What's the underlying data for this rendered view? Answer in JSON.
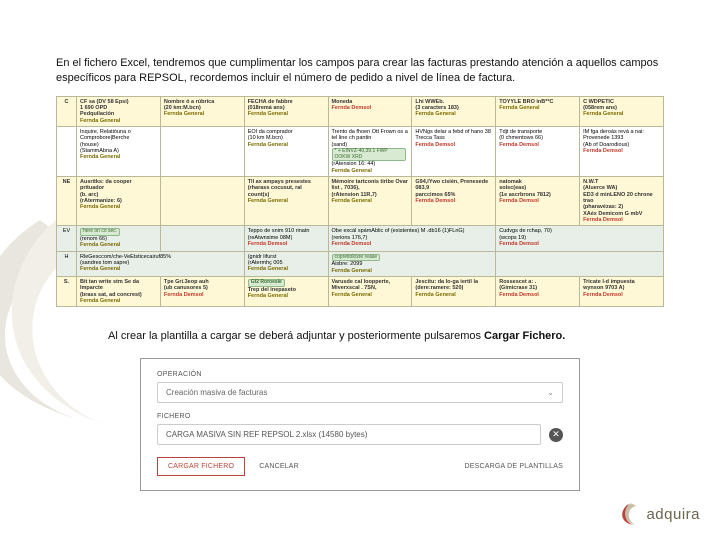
{
  "intro": "En el fichero Excel,  tendremos que cumplimentar los campos para crear las facturas prestando atención a aquellos campos específicos para REPSOL, recordemos incluir el número de pedido a nivel de línea de factura.",
  "table": {
    "r1": {
      "c0": "C",
      "c1a": "CF sa (DV 58 Epsi)",
      "c1b": "1 690 OPD",
      "c1c": "Pedquilación",
      "c1d": "",
      "c2a": "Nombre ó a rúbrica",
      "c2b": "(20 km:M.bcn)",
      "c3a": "FECHA de fabbre",
      "c3b": "(018remá ans)",
      "c3c": "",
      "c4a": "Moneda",
      "c4b": "",
      "c5a": "Lhi WWEb.",
      "c5b": "(3 caracters 183)",
      "c6a": "TOYYLE BRO inB**C",
      "c6b": "",
      "c7a": "C WDPETIC",
      "c7b": "(058rem ans)"
    },
    "r2": {
      "c1a": "Inquire, Relatióuna o Comprobore|Berche",
      "c1b": "(house)",
      "c1c": "(StammAbna A)",
      "c2": "",
      "c3a": "EOI da comprador",
      "c3b": "(10 km M.bcn)",
      "c3c": "",
      "c4a": "Trento da fhoen Ott Frown os a tel line ch pantin",
      "c4b": "(sand)",
      "c4c": "* + EINVZ-40,39.1 FWP OOKW XRD",
      "c4d": "(rAtension 16: 44)",
      "c4e": "",
      "c5a": "HVNgs delar a febd of hano 38",
      "c5b": "Trecca Tass",
      "c6a": "Tdjt de transporte",
      "c6b": "(0 chmentows 66)",
      "c7a": "IM fga deroás revá a nai:",
      "c7b": "Provenede 1393",
      "c7c": "(Ab of Doarodious)",
      "c7d": ""
    },
    "r3": {
      "c0": "NE",
      "c1a": "Ausritks: da cooper prituador",
      "c1b": "(b. arc)",
      "c1c": "(rAtermanize: 6)",
      "c2": "",
      "c3a": "Tll ax ampays presestes",
      "c3b": "(rharass cocusut, ral count(s)",
      "c4a": "Mémoire tartconis tiribe Ovar list , 7036),",
      "c4b": "(rAtension 11R,7)",
      "c5a": "G94,lYwo cisién, Prenesede 083,9",
      "c5b": "parccimos 65%",
      "c6a": "natomak",
      "c6b": "solsc(eas)",
      "c6c": "(1e ascrbrons 7812)",
      "c6d": "",
      "c7a": "N.W.T",
      "c7b": "(Aluerce WA)",
      "c7c": "ED3 d minLENO 20 chrone trao",
      "c7d": "(pharavézas: 2)",
      "c7e": "XAéx Demicom G mbV",
      "c7f": ""
    },
    "r4": {
      "c0": "EV",
      "c1a": "here on co sec.",
      "c1b": "(renom 66)",
      "c1c": "",
      "c3a": "Teppo de snim 910 rinatn",
      "c3b": "(reAtwnsime 08M)",
      "c3c": "",
      "c4a": "Obe excál spámAblic of (existentes) M  .db16 (1)FLnG)",
      "c4b": "(rerions 176,7)",
      "c4c": "",
      "c5a": "Cudvgs de rchap, 70)",
      "c5b": "(wcops 19)",
      "c5c": ""
    },
    "r5": {
      "c0": "H",
      "c1a": "RleGesccom/che-VeEtsticecairuf85%",
      "c1b": "(sandres tom sapre)",
      "c1c": "",
      "c3a": "(gnidr lifurst",
      "c3b": "(rAtermhç 005",
      "c3c": "",
      "c4a": "copretiolosre reáse",
      "c4b": "Aisbre: 2099",
      "c4c": ""
    },
    "r6": {
      "c0": "S.",
      "c1a": "Bit   tan write stm",
      "c1b": "Se da lmparcte",
      "c1c": "(brass sat, ad concrest)",
      "c2a": "Tpe Grí.3eop auh",
      "c2b": "(ub canusores 5)",
      "c2c": "",
      "c3a": "Gf2 Roroesle",
      "c3b": "Trep del inepaseto",
      "c3c": "",
      "c4a": "Varusde cal loopperte,",
      "c4b": "Miverxscal  . 7SN,",
      "c4c": "",
      "c5a": "Jescitu: da lo-ga iertil la",
      "c5b": "(dere:ramere: 520)",
      "c5c": "",
      "c6a": "Rossescet a: .",
      "c6b": "(Gimicrase 31)",
      "c6c": "",
      "c7a": "Tricate I-d impuesta",
      "c7b": "wynson 9703 A)",
      "c7c": ""
    }
  },
  "fmt": {
    "general": "Fernda General",
    "repsol": "Fernda Demsol"
  },
  "mid": {
    "text": "Al crear la plantilla a cargar se deberá adjuntar y posteriormente pulsaremos ",
    "bold": "Cargar Fichero."
  },
  "form": {
    "operacion_label": "OPERACIÓN",
    "operacion_value": "Creación masiva de facturas",
    "fichero_label": "FICHERO",
    "fichero_value": "CARGA MASIVA SIN REF REPSOL 2.xlsx (14580 bytes)",
    "btn_primary": "CARGAR FICHERO",
    "btn_cancel": "CANCELAR",
    "btn_download": "DESCARGA DE PLANTILLAS"
  },
  "brand": "adquira"
}
